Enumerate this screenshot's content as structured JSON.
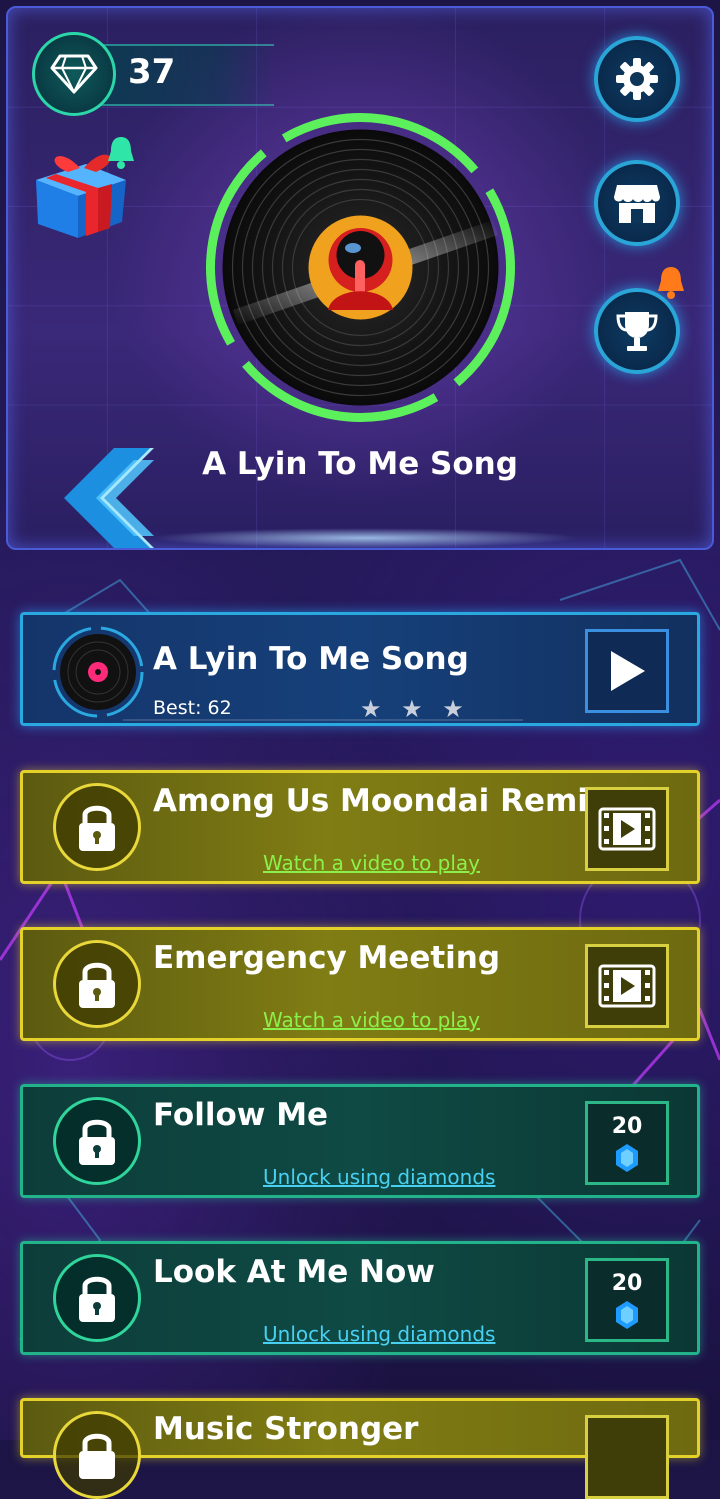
{
  "diamonds": {
    "count": "37",
    "icon": "diamond-icon"
  },
  "header": {
    "current_song": "A Lyin To Me Song",
    "buttons": [
      "gear-icon",
      "shop-icon",
      "trophy-icon"
    ],
    "gift_icon": "gift-icon",
    "back_icon": "chevron-left-icon"
  },
  "songs": [
    {
      "title": "A Lyin To Me Song",
      "status": "unlocked",
      "best_label": "Best: 62",
      "stars": "★ ★ ★",
      "action": "play-icon"
    },
    {
      "title": "Among Us Moondai Remix",
      "status": "video",
      "subtitle": "Watch a video to play",
      "action": "video-icon"
    },
    {
      "title": "Emergency Meeting",
      "status": "video",
      "subtitle": "Watch a video to play",
      "action": "video-icon"
    },
    {
      "title": "Follow Me",
      "status": "diamonds",
      "subtitle": "Unlock using diamonds",
      "cost": "20",
      "action": "diamond-icon"
    },
    {
      "title": "Look At Me Now",
      "status": "diamonds",
      "subtitle": "Unlock using diamonds",
      "cost": "20",
      "action": "diamond-icon"
    },
    {
      "title": "Music Stronger",
      "status": "video",
      "action": "video-icon"
    }
  ],
  "colors": {
    "accent_blue": "#2aa8e0",
    "video_yellow": "#e4d22a",
    "gem_green": "#23b38a",
    "vinyl_glow": "#5cf05c"
  }
}
